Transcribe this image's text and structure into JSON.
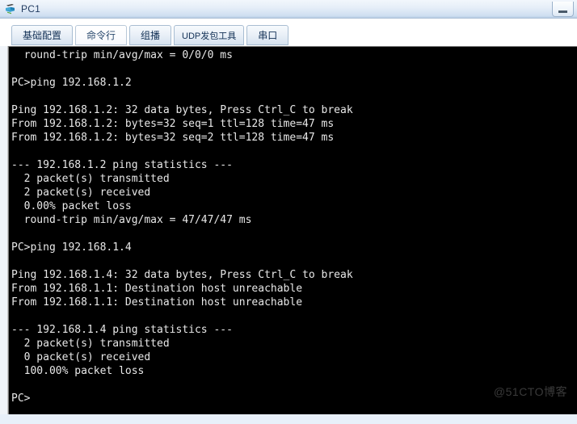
{
  "window": {
    "title": "PC1",
    "icon": "pc-device-icon",
    "minimize_label": "–"
  },
  "tabs": [
    {
      "label": "基础配置",
      "active": false,
      "small": false
    },
    {
      "label": "命令行",
      "active": true,
      "small": false
    },
    {
      "label": "组播",
      "active": false,
      "small": false
    },
    {
      "label": "UDP发包工具",
      "active": false,
      "small": true
    },
    {
      "label": "串口",
      "active": false,
      "small": false
    }
  ],
  "terminal": {
    "lines": [
      "  round-trip min/avg/max = 0/0/0 ms",
      "",
      "PC>ping 192.168.1.2",
      "",
      "Ping 192.168.1.2: 32 data bytes, Press Ctrl_C to break",
      "From 192.168.1.2: bytes=32 seq=1 ttl=128 time=47 ms",
      "From 192.168.1.2: bytes=32 seq=2 ttl=128 time=47 ms",
      "",
      "--- 192.168.1.2 ping statistics ---",
      "  2 packet(s) transmitted",
      "  2 packet(s) received",
      "  0.00% packet loss",
      "  round-trip min/avg/max = 47/47/47 ms",
      "",
      "PC>ping 192.168.1.4",
      "",
      "Ping 192.168.1.4: 32 data bytes, Press Ctrl_C to break",
      "From 192.168.1.1: Destination host unreachable",
      "From 192.168.1.1: Destination host unreachable",
      "",
      "--- 192.168.1.4 ping statistics ---",
      "  2 packet(s) transmitted",
      "  0 packet(s) received",
      "  100.00% packet loss",
      "",
      "PC>"
    ]
  },
  "watermark": {
    "text": "@51CTO博客"
  },
  "colors": {
    "terminal_bg": "#000000",
    "terminal_fg": "#e8e8e8",
    "titlebar_accent": "#cfdff1",
    "tab_active_bg": "#ffffff"
  }
}
